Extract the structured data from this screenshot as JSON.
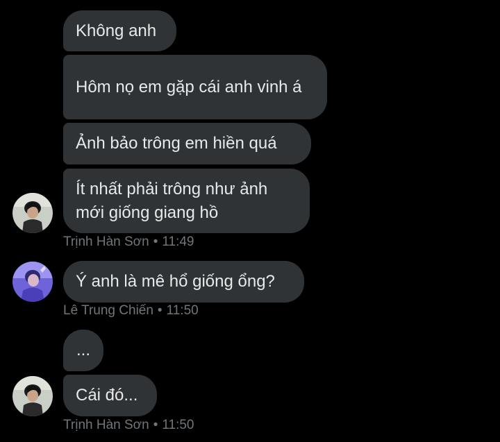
{
  "messages": [
    {
      "text": "Không anh"
    },
    {
      "text": "Hôm nọ em gặp cái anh vinh á"
    },
    {
      "text": "Ảnh bảo trông em hiền quá"
    },
    {
      "text": "Ít nhất phải trông như ảnh mới giống giang hồ"
    },
    {
      "text": "Ý anh là mê hổ giống ổng?"
    },
    {
      "text": "..."
    },
    {
      "text": "Cái đó..."
    }
  ],
  "meta": [
    {
      "sender": "Trịnh Hàn Sơn",
      "separator": "•",
      "time": "11:49"
    },
    {
      "sender": "Lê Trung Chiến",
      "separator": "•",
      "time": "11:50"
    },
    {
      "sender": "Trịnh Hàn Sơn",
      "separator": "•",
      "time": "11:50"
    }
  ],
  "avatars": [
    {
      "icon": "user-avatar-photo"
    },
    {
      "icon": "user-avatar-photo"
    },
    {
      "icon": "user-avatar-photo"
    }
  ],
  "colors": {
    "background": "#000000",
    "bubble": "#2f3336",
    "bubble_text": "#e7e9ea",
    "meta_text": "#71767b"
  }
}
